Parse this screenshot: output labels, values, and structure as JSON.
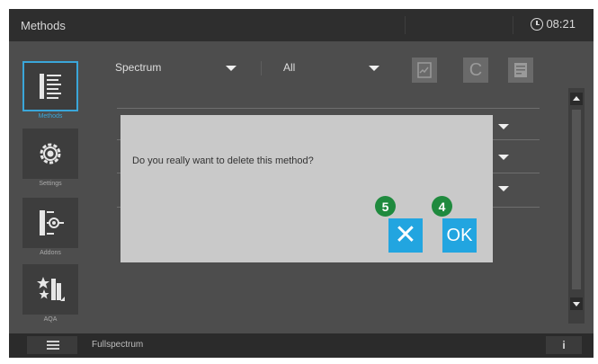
{
  "app": {
    "title": "Methods",
    "time": "08:21"
  },
  "sidebar": {
    "items": [
      {
        "label": "Methods",
        "icon": "methods-list-icon",
        "active": true
      },
      {
        "label": "Settings",
        "icon": "gear-icon",
        "active": false
      },
      {
        "label": "Addons",
        "icon": "addons-icon",
        "active": false
      },
      {
        "label": "AQA",
        "icon": "aqa-icon",
        "active": false
      }
    ]
  },
  "toolbar": {
    "type_selected": "Spectrum",
    "filter_selected": "All",
    "icons": [
      "report-icon",
      "c-icon",
      "document-icon"
    ]
  },
  "dialog": {
    "message": "Do you really want to delete this method?",
    "cancel_glyph": "✕",
    "ok_label": "OK",
    "cancel_badge": "5",
    "ok_badge": "4"
  },
  "bottombar": {
    "filename": "Fullspectrum",
    "info_label": "i"
  },
  "colors": {
    "accent": "#22a5e0",
    "badge": "#1f8a3e",
    "background": "#4d4d4d",
    "bars": "#2e2e2e"
  }
}
